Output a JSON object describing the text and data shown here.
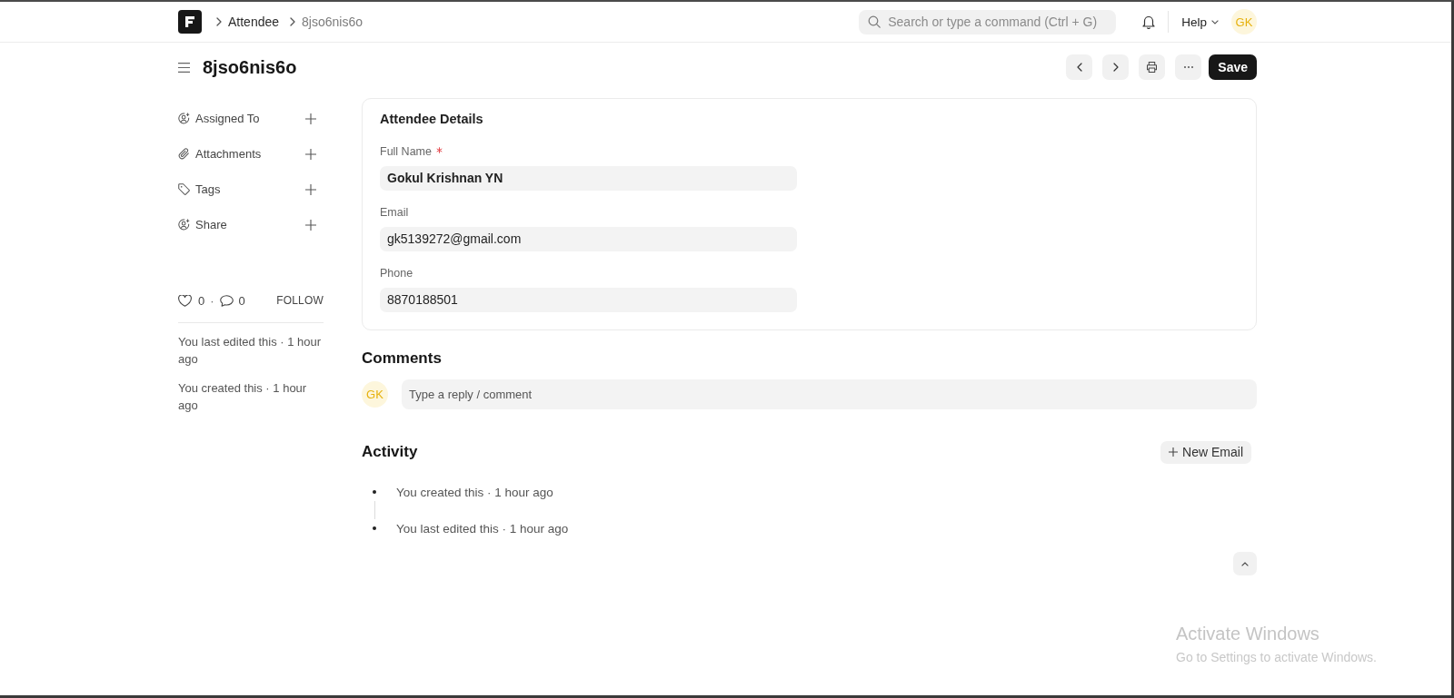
{
  "navbar": {
    "breadcrumbs": [
      {
        "label": "Attendee",
        "current": false
      },
      {
        "label": "8jso6nis6o",
        "current": true
      }
    ],
    "search": {
      "placeholder": "Search or type a command (Ctrl + G)"
    },
    "help_label": "Help",
    "avatar_initials": "GK"
  },
  "page_header": {
    "title": "8jso6nis6o",
    "save_label": "Save"
  },
  "sidebar": {
    "items": [
      {
        "label": "Assigned To",
        "kind": "assign"
      },
      {
        "label": "Attachments",
        "kind": "attachment"
      },
      {
        "label": "Tags",
        "kind": "tag"
      },
      {
        "label": "Share",
        "kind": "share"
      }
    ],
    "likes_count": "0",
    "separator": "·",
    "comments_count": "0",
    "follow_label": "FOLLOW",
    "history": [
      "You last edited this · 1 hour ago",
      "You created this · 1 hour ago"
    ]
  },
  "form": {
    "section_title": "Attendee Details",
    "fields": [
      {
        "label": "Full Name",
        "required": true,
        "bold": true,
        "value": "Gokul Krishnan YN"
      },
      {
        "label": "Email",
        "required": false,
        "bold": false,
        "value": "gk5139272@gmail.com"
      },
      {
        "label": "Phone",
        "required": false,
        "bold": false,
        "value": "8870188501"
      }
    ]
  },
  "comments": {
    "title": "Comments",
    "avatar_initials": "GK",
    "placeholder": "Type a reply / comment"
  },
  "activity": {
    "title": "Activity",
    "new_email_label": "New Email",
    "items": [
      "You created this · 1 hour ago",
      "You last edited this · 1 hour ago"
    ]
  },
  "os_notice": {
    "title": "Activate Windows",
    "subtitle": "Go to Settings to activate Windows."
  }
}
